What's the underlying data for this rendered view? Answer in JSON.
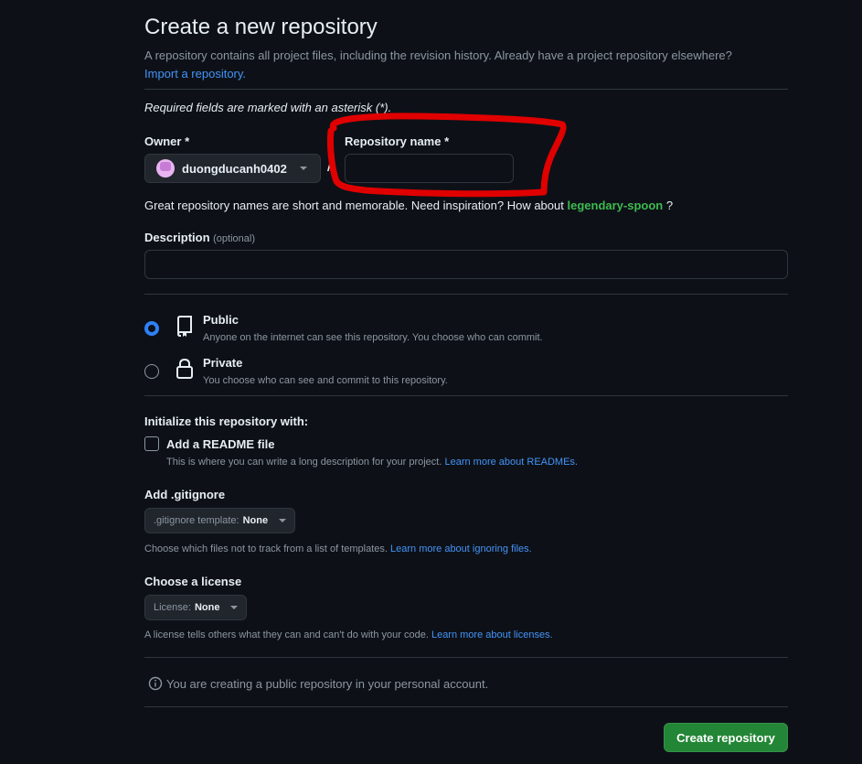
{
  "header": {
    "title": "Create a new repository",
    "subtitle": "A repository contains all project files, including the revision history. Already have a project repository elsewhere?",
    "import_link": "Import a repository."
  },
  "required_note": "Required fields are marked with an asterisk (*).",
  "owner": {
    "label": "Owner *",
    "value": "duongducanh0402"
  },
  "separator": "/",
  "repo_name": {
    "label": "Repository name *",
    "value": "",
    "placeholder": ""
  },
  "inspiration": {
    "text": "Great repository names are short and memorable. Need inspiration? How about",
    "suggestion": "legendary-spoon",
    "suffix": "?"
  },
  "description": {
    "label": "Description",
    "optional": "(optional)",
    "value": ""
  },
  "visibility": {
    "public": {
      "label": "Public",
      "desc": "Anyone on the internet can see this repository. You choose who can commit.",
      "selected": true
    },
    "private": {
      "label": "Private",
      "desc": "You choose who can see and commit to this repository.",
      "selected": false
    }
  },
  "init": {
    "heading": "Initialize this repository with:",
    "readme_label": "Add a README file",
    "readme_desc": "This is where you can write a long description for your project.",
    "readme_link": "Learn more about READMEs.",
    "readme_checked": false
  },
  "gitignore": {
    "heading": "Add .gitignore",
    "select_prefix": ".gitignore template:",
    "select_value": "None",
    "desc": "Choose which files not to track from a list of templates.",
    "link": "Learn more about ignoring files."
  },
  "license": {
    "heading": "Choose a license",
    "select_prefix": "License:",
    "select_value": "None",
    "desc": "A license tells others what they can and can't do with your code.",
    "link": "Learn more about licenses."
  },
  "info_note": "You are creating a public repository in your personal account.",
  "create_button": "Create repository",
  "colors": {
    "accent_link": "#4493f8",
    "success": "#238636",
    "annotation": "#e00000"
  },
  "icons": [
    "chevron-down-icon",
    "repo-icon",
    "lock-icon",
    "info-icon"
  ]
}
